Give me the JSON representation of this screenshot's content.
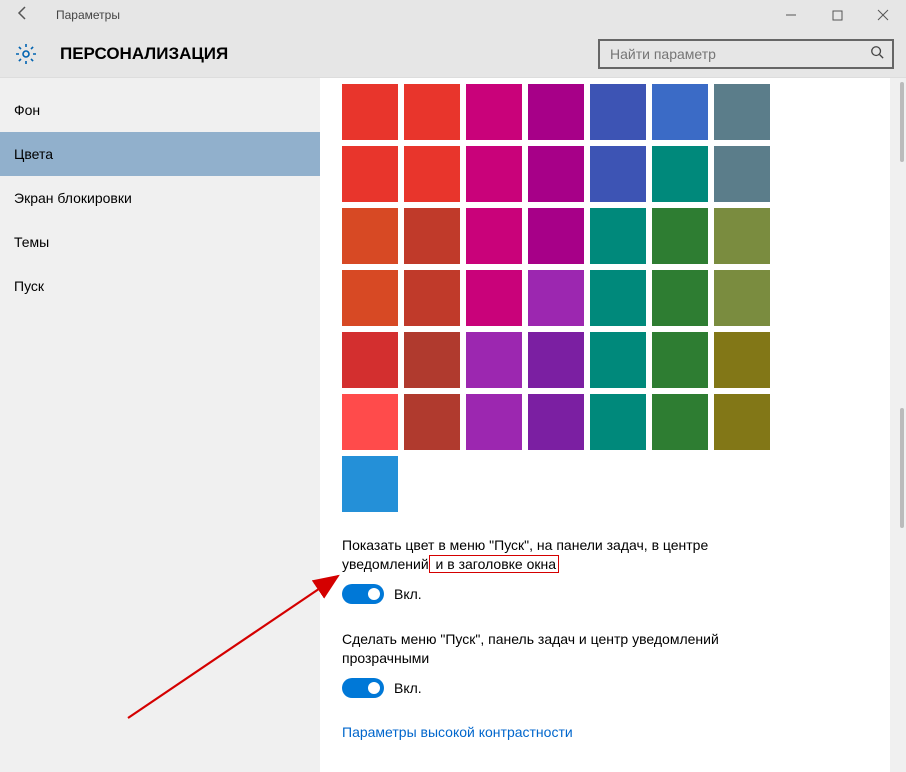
{
  "window": {
    "title": "Параметры"
  },
  "header": {
    "category": "ПЕРСОНАЛИЗАЦИЯ",
    "search_placeholder": "Найти параметр"
  },
  "sidebar": {
    "items": [
      {
        "label": "Фон",
        "selected": false
      },
      {
        "label": "Цвета",
        "selected": true
      },
      {
        "label": "Экран блокировки",
        "selected": false
      },
      {
        "label": "Темы",
        "selected": false
      },
      {
        "label": "Пуск",
        "selected": false
      }
    ]
  },
  "content": {
    "palette": [
      [
        "#E8352C",
        "#E8352C",
        "#C9027A",
        "#A70088",
        "#3D54B4",
        "#3B6BC6",
        "#5B7D8A"
      ],
      [
        "#E8352C",
        "#E8352C",
        "#C9027A",
        "#A70088",
        "#3D54B4",
        "#00897B",
        "#5B7D8A"
      ],
      [
        "#D74924",
        "#C03A2A",
        "#C9027A",
        "#A70088",
        "#00897B",
        "#2E7D32",
        "#7A8C3F"
      ],
      [
        "#D74924",
        "#C03A2A",
        "#C9027A",
        "#9C27B0",
        "#00897B",
        "#2E7D32",
        "#7A8C3F"
      ],
      [
        "#D32F2F",
        "#B03A2E",
        "#9C27B0",
        "#7B1FA2",
        "#00897B",
        "#2E7D32",
        "#827717"
      ],
      [
        "#FF4B4B",
        "#B03A2E",
        "#9C27B0",
        "#7B1FA2",
        "#00897B",
        "#2E7D32",
        "#827717"
      ]
    ],
    "selected_color": "#2490D8",
    "setting1": {
      "label_pre": "Показать цвет в меню \"Пуск\", на панели задач, в центре уведомлений",
      "label_highlight": " и в заголовке окна",
      "state": "Вкл."
    },
    "setting2": {
      "label": "Сделать меню \"Пуск\", панель задач и центр уведомлений прозрачными",
      "state": "Вкл."
    },
    "link": "Параметры высокой контрастности"
  }
}
